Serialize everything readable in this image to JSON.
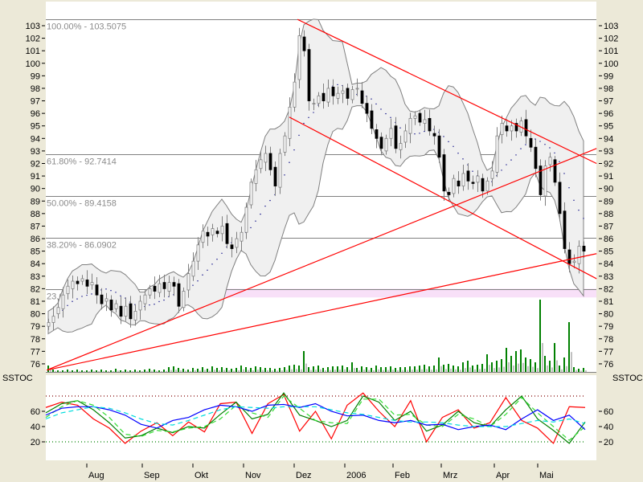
{
  "chart_data": {
    "type": "candlestick",
    "price_axis": {
      "min": 76,
      "max": 103,
      "ticks": [
        76,
        77,
        78,
        79,
        80,
        81,
        82,
        83,
        84,
        85,
        86,
        87,
        88,
        89,
        90,
        91,
        92,
        93,
        94,
        95,
        96,
        97,
        98,
        99,
        100,
        101,
        102,
        103
      ]
    },
    "month_labels": [
      "Aug",
      "Sep",
      "Okt",
      "Nov",
      "Dez",
      "2006",
      "Feb",
      "Mrz",
      "Apr",
      "Mai"
    ],
    "month_bar_index": [
      8,
      19.5,
      30,
      40.5,
      51,
      61.5,
      71.5,
      81.5,
      92.5,
      101.5
    ],
    "closes": [
      79.3,
      79.8,
      80.5,
      81.5,
      82.2,
      82.6,
      82.4,
      82.8,
      82.2,
      82.5,
      81.5,
      80.8,
      81.2,
      80.3,
      80.8,
      79.8,
      80.6,
      79.6,
      80.2,
      81.0,
      81.5,
      82.0,
      81.8,
      82.4,
      82.0,
      82.5,
      82.2,
      80.6,
      81.8,
      83.2,
      84.2,
      85.5,
      86.6,
      86.2,
      86.8,
      86.4,
      87.0,
      85.6,
      85.2,
      86.0,
      86.5,
      88.5,
      90.5,
      91.5,
      92.3,
      92.8,
      91.5,
      90.2,
      92.8,
      94.2,
      96.5,
      98.5,
      102.2,
      101.0,
      97.0,
      96.8,
      97.4,
      97.0,
      98.0,
      97.4,
      97.6,
      97.8,
      97.2,
      97.9,
      98.0,
      96.8,
      96.0,
      94.8,
      94.0,
      93.2,
      94.0,
      94.8,
      93.2,
      93.6,
      94.6,
      95.6,
      95.8,
      95.3,
      95.5,
      94.6,
      94.2,
      92.5,
      89.8,
      89.5,
      90.8,
      90.2,
      91.2,
      90.6,
      90.4,
      91.0,
      89.8,
      90.6,
      91.4,
      94.2,
      95.2,
      94.6,
      95.0,
      94.6,
      95.4,
      94.2,
      93.3,
      91.6,
      89.5,
      91.8,
      92.5,
      90.5,
      88.0,
      85.2,
      84.0,
      84.2,
      85.4,
      85.0
    ],
    "volume": [
      8,
      3,
      2,
      2,
      3,
      2,
      3,
      2,
      2,
      3,
      2,
      3,
      2,
      2,
      4,
      2,
      3,
      2,
      3,
      2,
      3,
      4,
      3,
      2,
      3,
      6,
      7,
      5,
      4,
      3,
      5,
      4,
      6,
      4,
      7,
      5,
      6,
      5,
      4,
      5,
      8,
      6,
      5,
      7,
      6,
      5,
      5,
      4,
      5,
      6,
      8,
      9,
      8,
      26,
      6,
      7,
      8,
      5,
      6,
      7,
      7,
      8,
      6,
      12,
      5,
      7,
      6,
      5,
      8,
      6,
      6,
      7,
      5,
      6,
      6,
      7,
      7,
      8,
      9,
      7,
      8,
      18,
      9,
      10,
      8,
      7,
      12,
      14,
      8,
      9,
      10,
      22,
      12,
      14,
      16,
      30,
      20,
      26,
      28,
      18,
      16,
      12,
      90,
      20,
      14,
      36,
      8,
      18,
      62,
      6,
      4,
      5
    ],
    "fibonacci": [
      {
        "label": "100.00% - 103.5075",
        "value": 103.5075
      },
      {
        "label": "61.80% - 92.7414",
        "value": 92.7414
      },
      {
        "label": "50.00% - 89.4158",
        "value": 89.4158
      },
      {
        "label": "38.20% - 86.0902",
        "value": 86.0902
      },
      {
        "label": "23.60% - 81.9750",
        "value": 81.975
      }
    ],
    "support_zone": {
      "from": 81.3,
      "to": 82.0
    },
    "trendlines": [
      {
        "from": [
          -0.3,
          75.5
        ],
        "to": [
          113.7,
          93.2
        ]
      },
      {
        "from": [
          -0.3,
          75.5
        ],
        "to": [
          113.7,
          84.8
        ]
      },
      {
        "from": [
          51.7,
          103.5
        ],
        "to": [
          113.7,
          92.0
        ]
      },
      {
        "from": [
          50,
          95.7
        ],
        "to": [
          113.7,
          82.8
        ]
      }
    ],
    "stochastic": {
      "title": "SSTOC",
      "ticks": [
        20,
        40,
        60
      ],
      "levels": {
        "upper": 80,
        "lower": 20
      },
      "series": [
        {
          "name": "fast",
          "color": "#ff0000",
          "values": [
            65,
            72,
            68,
            50,
            38,
            18,
            34,
            45,
            28,
            46,
            33,
            70,
            72,
            31,
            70,
            82,
            34,
            60,
            24,
            68,
            84,
            60,
            40,
            74,
            20,
            52,
            62,
            38,
            45,
            78,
            48,
            38,
            18,
            66,
            65
          ]
        },
        {
          "name": "slow-k",
          "color": "#008000",
          "values": [
            58,
            70,
            74,
            62,
            45,
            25,
            28,
            38,
            32,
            40,
            38,
            56,
            72,
            50,
            56,
            84,
            55,
            48,
            40,
            48,
            80,
            72,
            48,
            60,
            34,
            42,
            60,
            45,
            40,
            62,
            80,
            50,
            35,
            18,
            46
          ]
        },
        {
          "name": "slow-d",
          "color": "#33dd33",
          "values": [
            52,
            66,
            74,
            68,
            52,
            30,
            27,
            35,
            33,
            38,
            40,
            50,
            68,
            58,
            52,
            80,
            64,
            48,
            45,
            44,
            76,
            76,
            55,
            56,
            42,
            40,
            56,
            50,
            40,
            56,
            78,
            58,
            40,
            22,
            40
          ]
        },
        {
          "name": "ma",
          "color": "#0000ff",
          "values": [
            55,
            64,
            66,
            66,
            62,
            55,
            43,
            38,
            48,
            52,
            62,
            68,
            66,
            60,
            68,
            69,
            65,
            70,
            60,
            54,
            55,
            48,
            45,
            48,
            42,
            43,
            36,
            40,
            42,
            36,
            50,
            62,
            48,
            55,
            36
          ]
        },
        {
          "name": "signal",
          "color": "#00dddd",
          "values": [
            50,
            58,
            62,
            66,
            64,
            58,
            50,
            44,
            42,
            48,
            55,
            62,
            66,
            65,
            64,
            66,
            66,
            66,
            62,
            58,
            56,
            52,
            48,
            46,
            46,
            45,
            42,
            40,
            40,
            40,
            44,
            48,
            46,
            50,
            44
          ]
        }
      ]
    }
  }
}
